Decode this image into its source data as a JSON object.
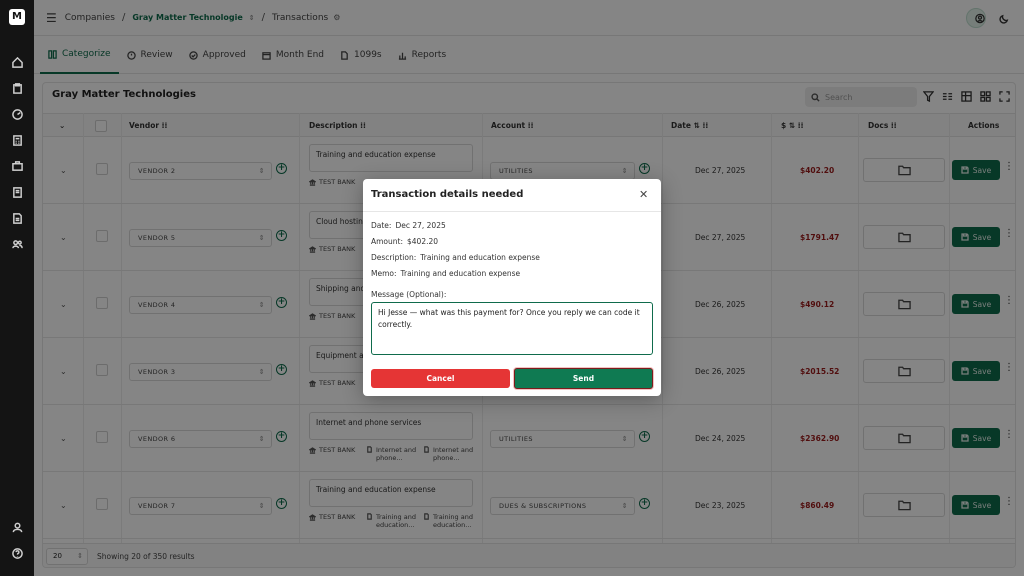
{
  "breadcrumb": {
    "root": "Companies",
    "company": "Gray Matter Technologie",
    "page": "Transactions"
  },
  "tabs": [
    {
      "label": "Categorize"
    },
    {
      "label": "Review"
    },
    {
      "label": "Approved"
    },
    {
      "label": "Month End"
    },
    {
      "label": "1099s"
    },
    {
      "label": "Reports"
    }
  ],
  "panel": {
    "title": "Gray Matter Technologies",
    "search_placeholder": "Search"
  },
  "columns": {
    "vendor": "Vendor",
    "description": "Description",
    "account": "Account",
    "date": "Date",
    "amount": "$",
    "docs": "Docs",
    "actions": "Actions"
  },
  "rows": [
    {
      "vendor": "VENDOR 2",
      "description": "Training and education expense",
      "bank": "TEST BANK",
      "attachments": [],
      "account": "UTILITIES",
      "date": "Dec 27, 2025",
      "amount": "$402.20"
    },
    {
      "vendor": "VENDOR 5",
      "description": "Cloud hosting",
      "bank": "TEST BANK",
      "attachments": [],
      "account": "",
      "date": "Dec 27, 2025",
      "amount": "$1791.47"
    },
    {
      "vendor": "VENDOR 4",
      "description": "Shipping and",
      "bank": "TEST BANK",
      "attachments": [],
      "account": "",
      "date": "Dec 26, 2025",
      "amount": "$490.12"
    },
    {
      "vendor": "VENDOR 3",
      "description": "Equipment an",
      "bank": "TEST BANK",
      "attachments": [],
      "account": "",
      "date": "Dec 26, 2025",
      "amount": "$2015.52"
    },
    {
      "vendor": "VENDOR 6",
      "description": "Internet and phone services",
      "bank": "TEST BANK",
      "attachments": [
        {
          "l1": "Internet and",
          "l2": "phone..."
        },
        {
          "l1": "Internet and",
          "l2": "phone..."
        }
      ],
      "account": "UTILITIES",
      "date": "Dec 24, 2025",
      "amount": "$2362.90"
    },
    {
      "vendor": "VENDOR 7",
      "description": "Training and education expense",
      "bank": "TEST BANK",
      "attachments": [
        {
          "l1": "Training and",
          "l2": "education..."
        },
        {
          "l1": "Training and",
          "l2": "education..."
        }
      ],
      "account": "DUES & SUBSCRIPTIONS",
      "date": "Dec 23, 2025",
      "amount": "$860.49"
    }
  ],
  "save_label": "Save",
  "footer": {
    "page_size": "20",
    "showing": "Showing 20 of 350 results"
  },
  "modal": {
    "title": "Transaction details needed",
    "date_label": "Date:",
    "date": "Dec 27, 2025",
    "amount_label": "Amount:",
    "amount": "$402.20",
    "description_label": "Description:",
    "description": "Training and education expense",
    "memo_label": "Memo:",
    "memo": "Training and education expense",
    "message_label": "Message (Optional):",
    "message": "Hi Jesse — what was this payment for? Once you reply we can code it correctly.",
    "cancel": "Cancel",
    "send": "Send"
  },
  "colors": {
    "brand": "#0f6b4c",
    "danger": "#e53535",
    "amount": "#9b1c1c"
  }
}
